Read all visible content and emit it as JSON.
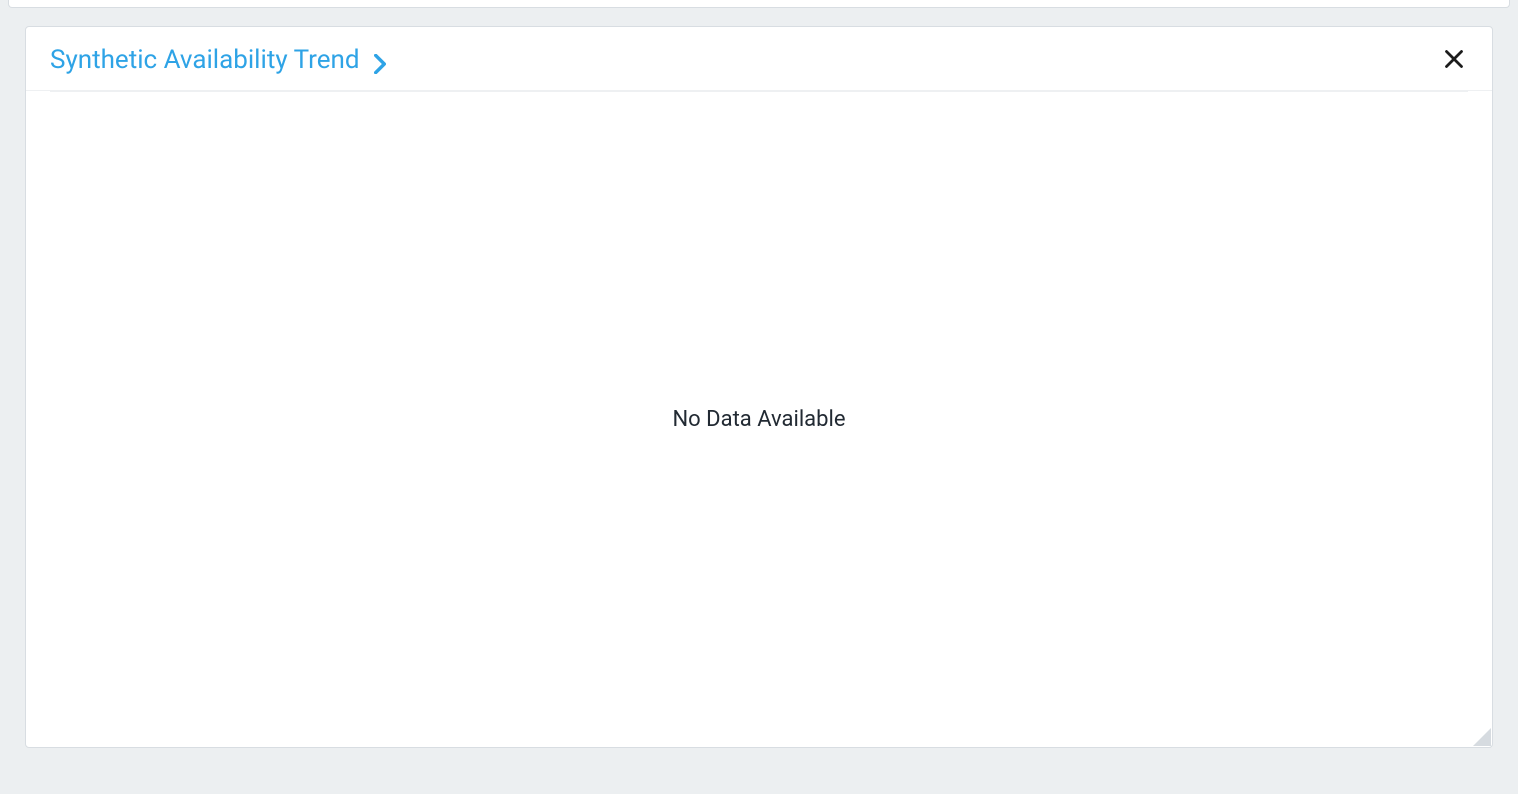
{
  "panel": {
    "title": "Synthetic Availability Trend",
    "empty_message": "No Data Available"
  }
}
